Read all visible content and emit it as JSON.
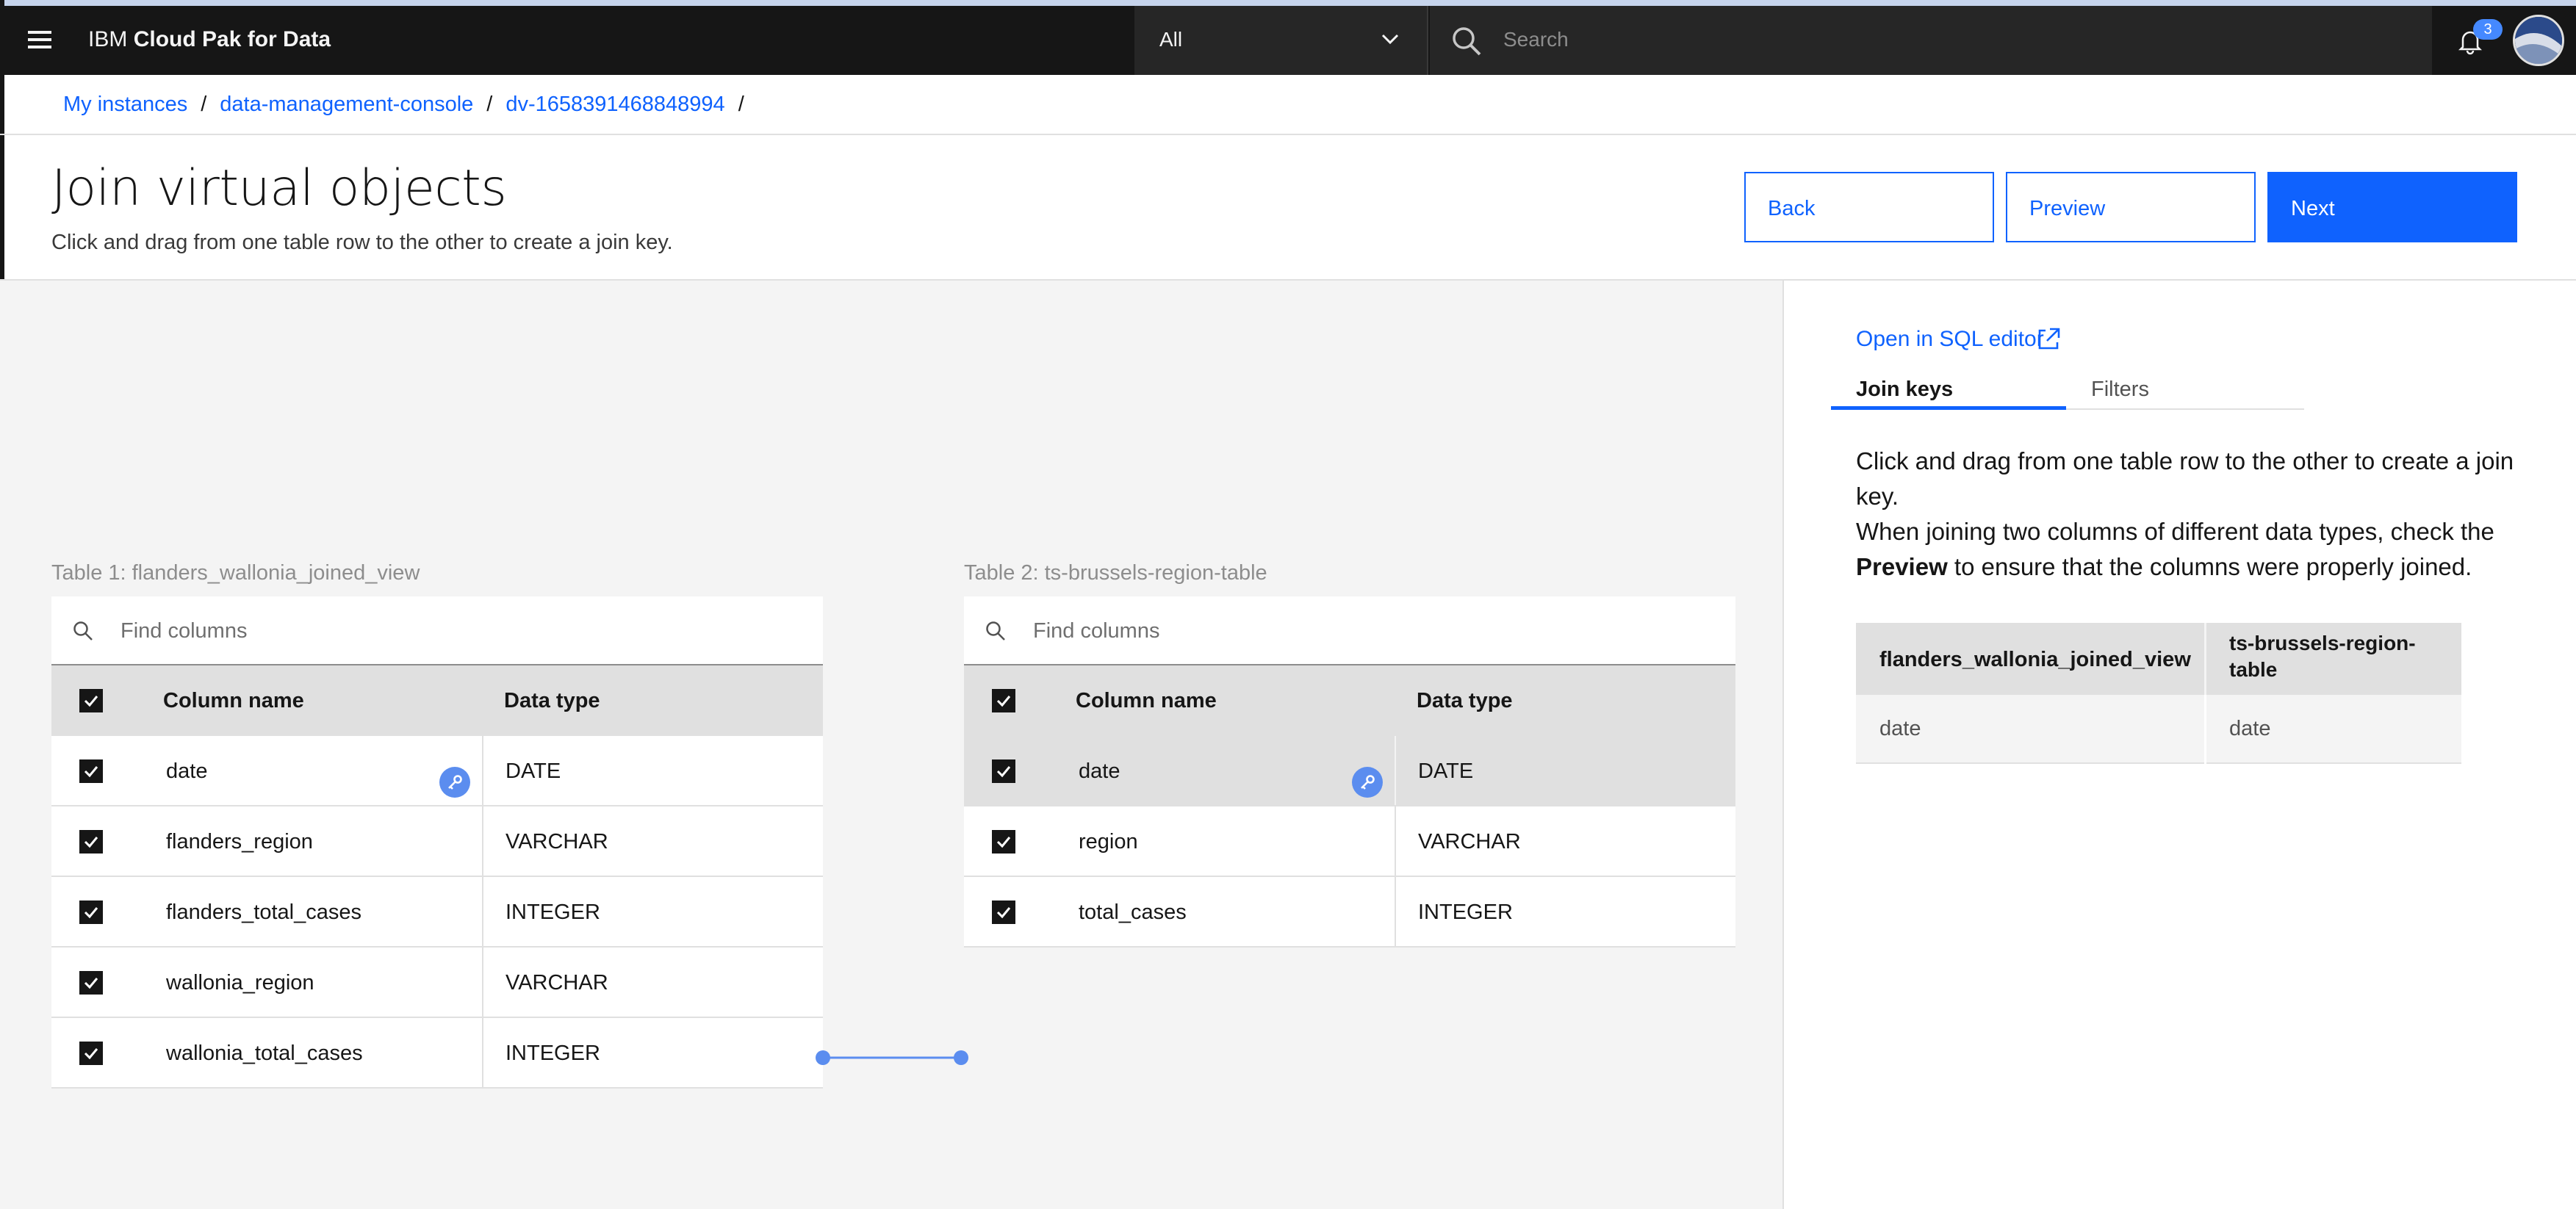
{
  "header": {
    "brand_prefix": "IBM",
    "brand_name": "Cloud Pak for Data",
    "scope_value": "All",
    "search_placeholder": "Search",
    "notification_count": "3"
  },
  "breadcrumb": {
    "items": [
      "My instances",
      "data-management-console",
      "dv-1658391468848994"
    ],
    "separator": "/"
  },
  "page": {
    "title": "Join virtual objects",
    "subtitle": "Click and drag from one table row to the other to create a join key."
  },
  "actions": {
    "back": "Back",
    "preview": "Preview",
    "next": "Next"
  },
  "table1": {
    "label": "Table 1: flanders_wallonia_joined_view",
    "find_placeholder": "Find columns",
    "col_name_header": "Column name",
    "col_type_header": "Data type",
    "rows": [
      {
        "name": "date",
        "type": "DATE"
      },
      {
        "name": "flanders_region",
        "type": "VARCHAR"
      },
      {
        "name": "flanders_total_cases",
        "type": "INTEGER"
      },
      {
        "name": "wallonia_region",
        "type": "VARCHAR"
      },
      {
        "name": "wallonia_total_cases",
        "type": "INTEGER"
      }
    ]
  },
  "table2": {
    "label": "Table 2: ts-brussels-region-table",
    "find_placeholder": "Find columns",
    "col_name_header": "Column name",
    "col_type_header": "Data type",
    "rows": [
      {
        "name": "date",
        "type": "DATE"
      },
      {
        "name": "region",
        "type": "VARCHAR"
      },
      {
        "name": "total_cases",
        "type": "INTEGER"
      }
    ]
  },
  "side": {
    "sql_link": "Open in SQL editor",
    "tabs": [
      "Join keys",
      "Filters"
    ],
    "help_line1": "Click and drag from one table row to the other to create a join key.",
    "help_line2a": "When joining two columns of different data types, check the ",
    "help_line2b": "Preview",
    "help_line2c": " to ensure that the columns were properly joined.",
    "join_keys": {
      "headers": [
        "flanders_wallonia_joined_view",
        "ts-brussels-region-table"
      ],
      "rows": [
        [
          "date",
          "date"
        ]
      ]
    }
  },
  "icons": {
    "menu": "hamburger-menu-icon",
    "chevron": "chevron-down-icon",
    "search": "search-icon",
    "bell": "notification-icon",
    "key": "join-key-icon",
    "checkbox": "checkmark-icon",
    "launch": "launch-icon"
  },
  "colors": {
    "accent": "#0f62fe",
    "topbar": "#161616",
    "canvas": "#f4f4f4",
    "key_badge": "#5b8def"
  }
}
